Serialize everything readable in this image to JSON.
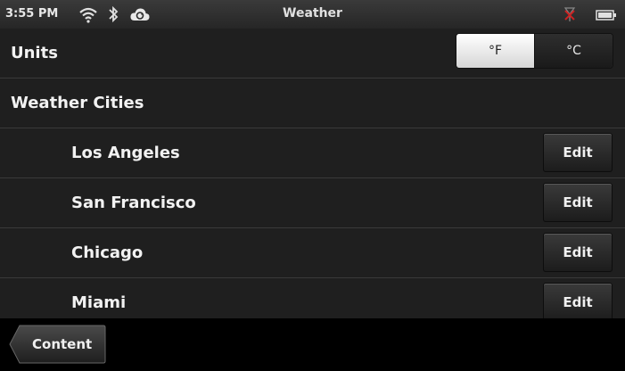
{
  "status_bar": {
    "time": "3:55 PM",
    "title": "Weather",
    "icons": [
      "wifi-icon",
      "bluetooth-icon",
      "cloud-sync-icon",
      "no-signal-icon",
      "battery-icon"
    ]
  },
  "units": {
    "label": "Units",
    "options": [
      "°F",
      "°C"
    ],
    "selected": "°F"
  },
  "cities_section": {
    "label": "Weather Cities",
    "cities": [
      {
        "name": "Los Angeles",
        "edit_label": "Edit"
      },
      {
        "name": "San Francisco",
        "edit_label": "Edit"
      },
      {
        "name": "Chicago",
        "edit_label": "Edit"
      },
      {
        "name": "Miami",
        "edit_label": "Edit"
      }
    ]
  },
  "bottom_bar": {
    "back_label": "Content"
  },
  "colors": {
    "list_background": "#1f1f1f",
    "divider": "#3a3a3a",
    "no_signal_red": "#cc2222"
  }
}
